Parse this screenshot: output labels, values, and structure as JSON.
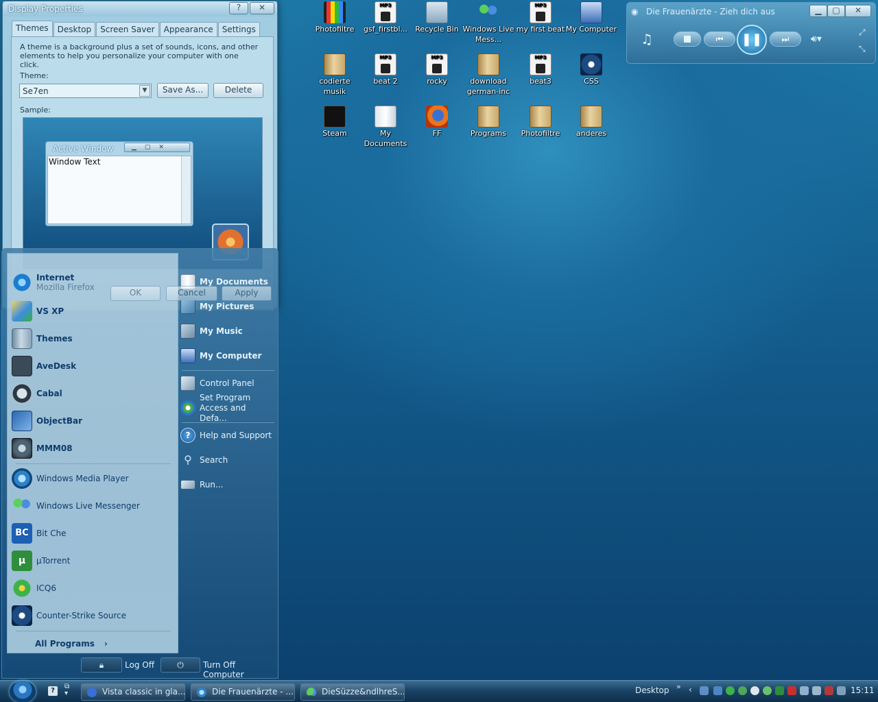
{
  "desktop_icons": [
    {
      "label": "Photofiltre",
      "icon": "film-icon"
    },
    {
      "label": "gsf_firstbl...",
      "icon": "mp3-file-icon"
    },
    {
      "label": "Recycle Bin",
      "icon": "recycle-bin-icon"
    },
    {
      "label": "Windows Live Mess...",
      "icon": "messenger-icon"
    },
    {
      "label": "my first beat",
      "icon": "mp3-file-icon"
    },
    {
      "label": "My Computer",
      "icon": "computer-icon"
    },
    {
      "label": "codierte musik",
      "icon": "folder-icon"
    },
    {
      "label": "beat 2",
      "icon": "mp3-file-icon"
    },
    {
      "label": "rocky",
      "icon": "mp3-file-icon"
    },
    {
      "label": "download german-inc",
      "icon": "folder-icon"
    },
    {
      "label": "beat3",
      "icon": "mp3-file-icon"
    },
    {
      "label": "CSS",
      "icon": "counter-strike-icon"
    },
    {
      "label": "Steam",
      "icon": "steam-icon"
    },
    {
      "label": "My Documents",
      "icon": "documents-icon"
    },
    {
      "label": "FF",
      "icon": "firefox-icon"
    },
    {
      "label": "Programs",
      "icon": "folder-icon"
    },
    {
      "label": "Photofiltre",
      "icon": "folder-icon"
    },
    {
      "label": "anderes",
      "icon": "folder-icon"
    }
  ],
  "display_properties": {
    "title": "Display Properties",
    "help_button": "?",
    "close_button": "✕",
    "tabs": [
      "Themes",
      "Desktop",
      "Screen Saver",
      "Appearance",
      "Settings"
    ],
    "description": "A theme is a background plus a set of sounds, icons, and other elements to help you personalize your computer with one click.",
    "theme_label": "Theme:",
    "theme_value": "Se7en",
    "save_as": "Save As...",
    "delete": "Delete",
    "sample_label": "Sample:",
    "sample_window_title": "Active Window",
    "sample_window_text": "Window Text",
    "ok": "OK",
    "cancel": "Cancel",
    "apply": "Apply"
  },
  "start_menu": {
    "pinned": [
      {
        "name": "Internet",
        "sub": "Mozilla Firefox",
        "icon": "internet-explorer-icon"
      },
      {
        "name": "VS XP",
        "icon": "vs-xp-icon"
      },
      {
        "name": "Themes",
        "icon": "themes-folder-icon"
      },
      {
        "name": "AveDesk",
        "icon": "avedesk-icon"
      },
      {
        "name": "Cabal",
        "icon": "cabal-icon"
      },
      {
        "name": "ObjectBar",
        "icon": "objectbar-icon"
      },
      {
        "name": "MMM08",
        "icon": "mmm08-icon"
      }
    ],
    "recent": [
      {
        "name": "Windows Media Player",
        "icon": "media-player-icon"
      },
      {
        "name": "Windows Live Messenger",
        "icon": "messenger-icon"
      },
      {
        "name": "Bit Che",
        "icon": "bitche-icon"
      },
      {
        "name": "µTorrent",
        "icon": "utorrent-icon"
      },
      {
        "name": "ICQ6",
        "icon": "icq-icon"
      },
      {
        "name": "Counter-Strike Source",
        "icon": "counter-strike-icon"
      }
    ],
    "all_programs": "All Programs",
    "right": [
      {
        "name": "My Documents",
        "icon": "documents-icon"
      },
      {
        "name": "My Pictures",
        "icon": "pictures-icon"
      },
      {
        "name": "My Music",
        "icon": "music-icon"
      },
      {
        "name": "My Computer",
        "icon": "computer-icon"
      },
      {
        "name": "Control Panel",
        "icon": "control-panel-icon"
      },
      {
        "name": "Set Program Access and Defa...",
        "icon": "program-access-icon"
      },
      {
        "name": "Help and Support",
        "icon": "help-icon"
      },
      {
        "name": "Search",
        "icon": "search-icon"
      },
      {
        "name": "Run...",
        "icon": "run-icon"
      }
    ],
    "log_off": "Log Off",
    "turn_off": "Turn Off Computer"
  },
  "media_player": {
    "title": "Die Frauenärzte - Zieh dich aus"
  },
  "taskbar": {
    "tasks": [
      "Vista classic in gla...",
      "Die Frauenärzte - ...",
      "DieSüzze&ndlhreS..."
    ],
    "desktop_label": "Desktop",
    "time": "15:11"
  },
  "colors": {
    "accent": "#1a6c9e",
    "taskbar": "#1b4466",
    "link_text": "#0e3c6b"
  }
}
